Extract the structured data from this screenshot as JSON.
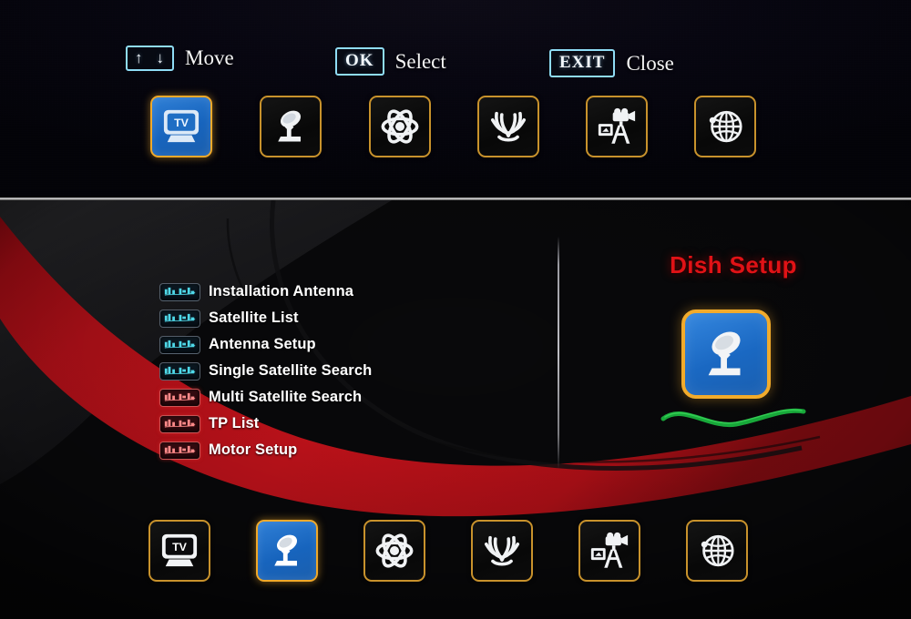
{
  "help_bar": {
    "items": [
      {
        "badge": "↑  ↓",
        "label": "Move",
        "name": "move"
      },
      {
        "badge": "OK",
        "label": "Select",
        "name": "select"
      },
      {
        "badge": "EXIT",
        "label": "Close",
        "name": "close"
      }
    ]
  },
  "top_nav": {
    "icons": [
      {
        "name": "tv-icon",
        "label": "TV",
        "selected": true
      },
      {
        "name": "satellite-dish-icon",
        "label": "Installation",
        "selected": false
      },
      {
        "name": "atom-icon",
        "label": "System Setup",
        "selected": false
      },
      {
        "name": "twisted-horns-icon",
        "label": "Tools",
        "selected": false
      },
      {
        "name": "camera-tripod-icon",
        "label": "Media",
        "selected": false
      },
      {
        "name": "globe-icon",
        "label": "Network",
        "selected": false
      }
    ]
  },
  "bottom_nav": {
    "icons": [
      {
        "name": "tv-icon",
        "label": "TV",
        "selected": false
      },
      {
        "name": "satellite-dish-icon",
        "label": "Installation",
        "selected": true
      },
      {
        "name": "atom-icon",
        "label": "System Setup",
        "selected": false
      },
      {
        "name": "twisted-horns-icon",
        "label": "Tools",
        "selected": false
      },
      {
        "name": "camera-tripod-icon",
        "label": "Media",
        "selected": false
      },
      {
        "name": "globe-icon",
        "label": "Network",
        "selected": false
      }
    ]
  },
  "menu": {
    "items": [
      {
        "label": "Installation Antenna",
        "on_red": false
      },
      {
        "label": "Satellite List",
        "on_red": false
      },
      {
        "label": "Antenna Setup",
        "on_red": false
      },
      {
        "label": "Single Satellite Search",
        "on_red": false
      },
      {
        "label": "Multi Satellite Search",
        "on_red": true
      },
      {
        "label": "TP List",
        "on_red": true
      },
      {
        "label": "Motor Setup",
        "on_red": true
      }
    ]
  },
  "panel": {
    "title": "Dish Setup",
    "icon_name": "satellite-dish-icon"
  },
  "colors": {
    "accent_orange": "#f0a92a",
    "selected_blue": "#1f6ec4",
    "title_red": "#e01216",
    "swoosh_red": "#c4121b",
    "help_cyan": "#8fdcf5",
    "wave_green": "#18a83a"
  }
}
